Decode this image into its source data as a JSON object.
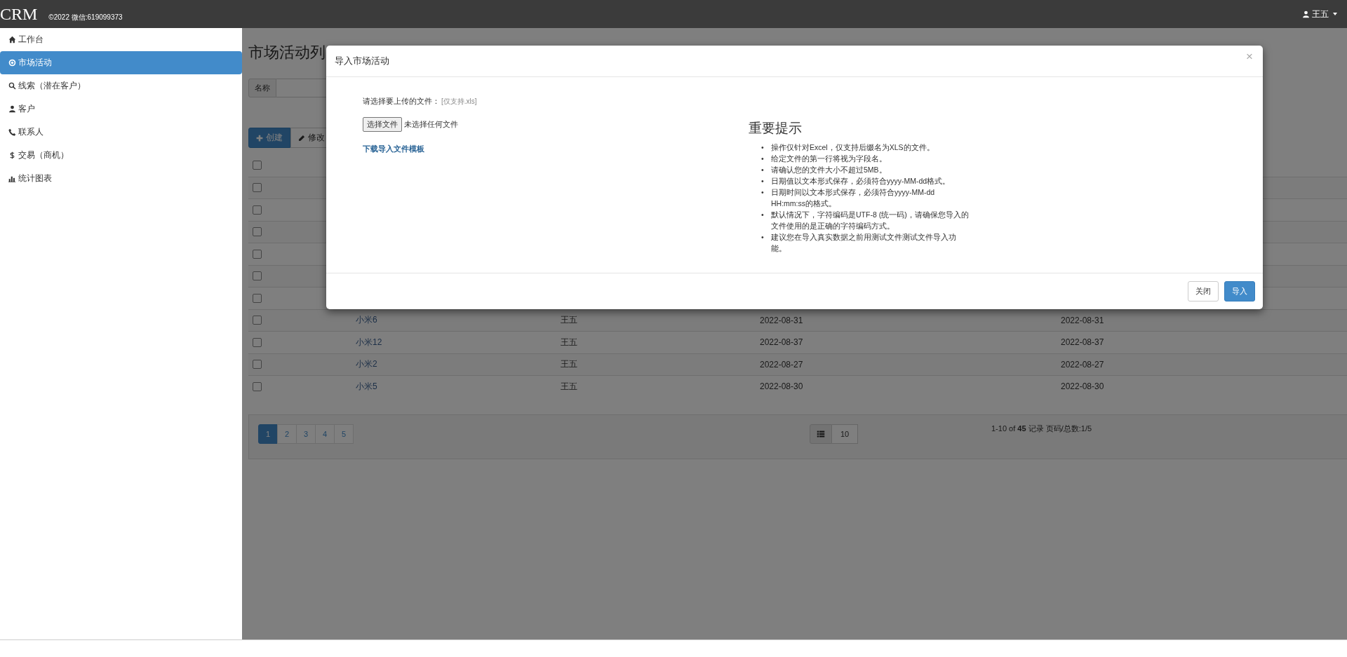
{
  "header": {
    "logo": "CRM",
    "copyright": "©2022 微信:619099373",
    "user": "王五"
  },
  "sidebar": {
    "items": [
      {
        "label": "工作台",
        "selected": false
      },
      {
        "label": "市场活动",
        "selected": true
      },
      {
        "label": "线索（潜在客户）",
        "selected": false
      },
      {
        "label": "客户",
        "selected": false
      },
      {
        "label": "联系人",
        "selected": false
      },
      {
        "label": "交易（商机）",
        "selected": false
      },
      {
        "label": "统计图表",
        "selected": false
      }
    ]
  },
  "main": {
    "title": "市场活动列",
    "search": {
      "label": "名称"
    },
    "toolbar": [
      {
        "label": "创建",
        "kind": "primary"
      },
      {
        "label": "修改",
        "kind": "default"
      }
    ],
    "table": {
      "header": {
        "checked": false
      },
      "rows": [
        {
          "checked": false
        },
        {
          "checked": false
        },
        {
          "checked": false
        },
        {
          "checked": false
        },
        {
          "checked": false
        },
        {
          "checked": false
        },
        {
          "checked": false,
          "name": "小米6",
          "owner": "王五",
          "start_date": "2022-08-31",
          "end_date": "2022-08-31"
        },
        {
          "checked": false,
          "name": "小米12",
          "owner": "王五",
          "start_date": "2022-08-37",
          "end_date": "2022-08-37"
        },
        {
          "checked": false,
          "name": "小米2",
          "owner": "王五",
          "start_date": "2022-08-27",
          "end_date": "2022-08-27"
        },
        {
          "checked": false,
          "name": "小米5",
          "owner": "王五",
          "start_date": "2022-08-30",
          "end_date": "2022-08-30"
        }
      ]
    },
    "pagination": {
      "pages": [
        {
          "label": "1",
          "selected": true
        },
        {
          "label": "2",
          "selected": false
        },
        {
          "label": "3",
          "selected": false
        },
        {
          "label": "4",
          "selected": false
        },
        {
          "label": "5",
          "selected": false
        }
      ],
      "page_size": "10",
      "summary": "1-10 of **45** 记录 页码/总数:1/5"
    }
  },
  "modal": {
    "title": "导入市场活动",
    "close": "×",
    "file_label": "请选择要上传的文件：",
    "file_hint": "[仅支持.xls]",
    "file_button": "选择文件",
    "file_status": "未选择任何文件",
    "download_link": "下载导入文件模板",
    "tips_title": "重要提示",
    "tips": [
      {
        "bullet": "•",
        "text": "操作仅针对Excel，仅支持后缀名为XLS的文件。"
      },
      {
        "bullet": "•",
        "text": "给定文件的第一行将视为字段名。"
      },
      {
        "bullet": "•",
        "text": "请确认您的文件大小不超过5MB。"
      },
      {
        "bullet": "•",
        "text": "日期值以文本形式保存，必须符合yyyy-MM-dd格式。"
      },
      {
        "bullet": "•",
        "text": "日期时间以文本形式保存，必须符合yyyy-MM-dd HH:mm:ss的格式。"
      },
      {
        "bullet": "•",
        "text": "默认情况下，字符编码是UTF-8 (统一码)，请确保您导入的文件使用的是正确的字符编码方式。"
      },
      {
        "bullet": "•",
        "text": "建议您在导入真实数据之前用测试文件测试文件导入功能。"
      }
    ],
    "buttons": [
      {
        "label": "关闭",
        "kind": "default"
      },
      {
        "label": "导入",
        "kind": "primary"
      }
    ]
  }
}
